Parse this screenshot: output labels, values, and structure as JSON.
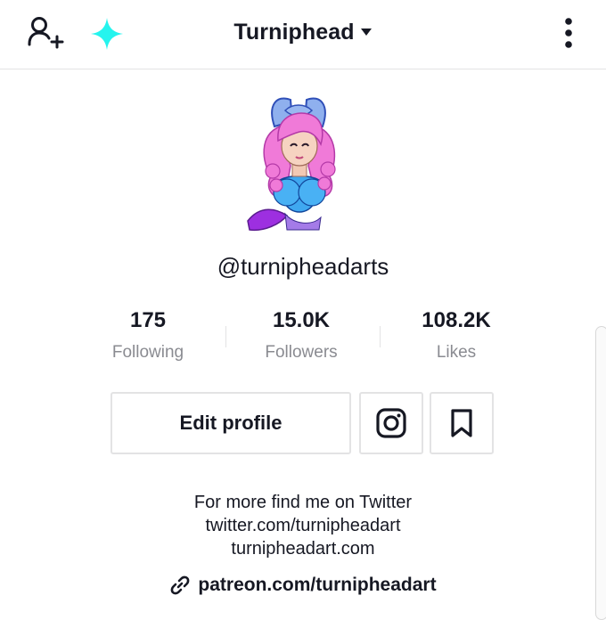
{
  "header": {
    "title": "Turniphead",
    "icons": {
      "left_primary": "add-user-icon",
      "left_secondary": "sparkle-icon",
      "right": "more-vertical-icon",
      "title_suffix": "caret-down-icon"
    },
    "sparkle_color": "#25F4EE"
  },
  "profile": {
    "username": "@turnipheadarts",
    "stats": [
      {
        "value": "175",
        "label": "Following"
      },
      {
        "value": "15.0K",
        "label": "Followers"
      },
      {
        "value": "108.2K",
        "label": "Likes"
      }
    ],
    "buttons": {
      "edit_label": "Edit profile",
      "instagram_icon": "instagram-icon",
      "bookmark_icon": "bookmark-icon"
    },
    "bio": {
      "line1": "For more find me on Twitter",
      "line2": "twitter.com/turnipheadart",
      "line3": "turnipheadart.com"
    },
    "link": "patreon.com/turnipheadart"
  }
}
